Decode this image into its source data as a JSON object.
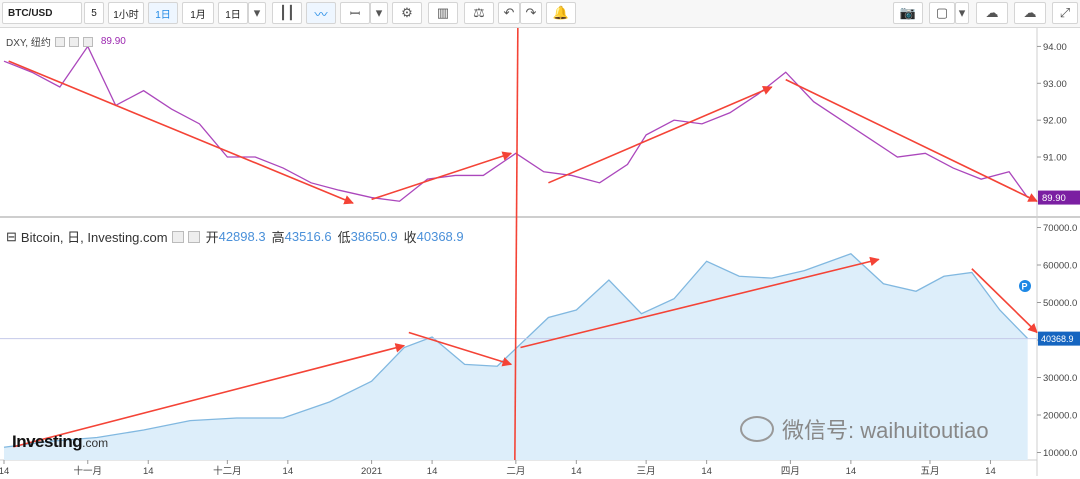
{
  "toolbar": {
    "symbol": "BTC/USD",
    "interval_value": "5",
    "btn_1h": "1小时",
    "btn_1d": "1日",
    "btn_1m": "1月",
    "btn_1d_dropdown": "1日"
  },
  "top_legend": {
    "name": "DXY, 纽约",
    "value": "89.90"
  },
  "bottom_legend": {
    "name": "Bitcoin, 日, Investing.com",
    "open_label": "开",
    "open": "42898.3",
    "high_label": "高",
    "high": "43516.6",
    "low_label": "低",
    "low": "38650.9",
    "close_label": "收",
    "close": "40368.9"
  },
  "logo": {
    "brand": "Investing",
    "suffix": ".com"
  },
  "watermark": "微信号: waihuitoutiao",
  "chart_data": [
    {
      "type": "line",
      "title": "DXY, 纽约",
      "x": [
        "2020-10-14",
        "2020-10-20",
        "2020-10-26",
        "2020-11-01",
        "2020-11-07",
        "2020-11-13",
        "2020-11-19",
        "2020-11-25",
        "2020-12-01",
        "2020-12-07",
        "2020-12-13",
        "2020-12-19",
        "2020-12-25",
        "2021-01-01",
        "2021-01-07",
        "2021-01-13",
        "2021-01-19",
        "2021-01-25",
        "2021-02-01",
        "2021-02-07",
        "2021-02-13",
        "2021-02-19",
        "2021-02-25",
        "2021-03-01",
        "2021-03-07",
        "2021-03-13",
        "2021-03-19",
        "2021-03-25",
        "2021-03-31",
        "2021-04-06",
        "2021-04-12",
        "2021-04-18",
        "2021-04-24",
        "2021-04-30",
        "2021-05-06",
        "2021-05-12",
        "2021-05-18",
        "2021-05-22"
      ],
      "values": [
        93.6,
        93.3,
        92.9,
        94.0,
        92.4,
        92.8,
        92.3,
        91.9,
        91.0,
        91.0,
        90.7,
        90.3,
        90.1,
        89.9,
        89.8,
        90.4,
        90.5,
        90.5,
        91.1,
        90.6,
        90.5,
        90.3,
        90.8,
        91.6,
        92.0,
        91.9,
        92.2,
        92.7,
        93.3,
        92.5,
        92.0,
        91.5,
        91.0,
        91.1,
        90.7,
        90.4,
        90.6,
        89.9
      ],
      "yticks": [
        91.0,
        92.0,
        93.0,
        94.0
      ],
      "ylim": [
        89.4,
        94.5
      ],
      "last_value_label": "89.90",
      "color": "#ab47bc",
      "trend_arrow_color": "#f44336"
    },
    {
      "type": "area",
      "title": "Bitcoin, 日, Investing.com",
      "x": [
        "2020-10-14",
        "2020-10-24",
        "2020-11-03",
        "2020-11-13",
        "2020-11-23",
        "2020-12-03",
        "2020-12-13",
        "2020-12-23",
        "2021-01-01",
        "2021-01-08",
        "2021-01-14",
        "2021-01-21",
        "2021-01-28",
        "2021-02-08",
        "2021-02-14",
        "2021-02-21",
        "2021-02-28",
        "2021-03-07",
        "2021-03-14",
        "2021-03-21",
        "2021-03-28",
        "2021-04-04",
        "2021-04-14",
        "2021-04-21",
        "2021-04-28",
        "2021-05-04",
        "2021-05-10",
        "2021-05-16",
        "2021-05-22"
      ],
      "values": [
        11400,
        13000,
        14000,
        16000,
        18500,
        19200,
        19200,
        23500,
        29000,
        38000,
        40800,
        33500,
        33000,
        46000,
        48000,
        56000,
        47000,
        51000,
        61000,
        57000,
        56500,
        58500,
        63000,
        55000,
        53000,
        57000,
        58000,
        48000,
        40368.9
      ],
      "yticks": [
        10000,
        20000,
        30000,
        40000,
        50000,
        60000,
        70000
      ],
      "ylim": [
        8000,
        72000
      ],
      "last_value_label": "40368.9",
      "xticks": [
        "14",
        "十一月",
        "14",
        "十二月",
        "14",
        "2021",
        "14",
        "二月",
        "14",
        "三月",
        "14",
        "四月",
        "14",
        "五月",
        "14"
      ],
      "line_color": "#81b8e0",
      "fill_color": "#ddeefa",
      "trend_arrow_color": "#f44336"
    }
  ]
}
